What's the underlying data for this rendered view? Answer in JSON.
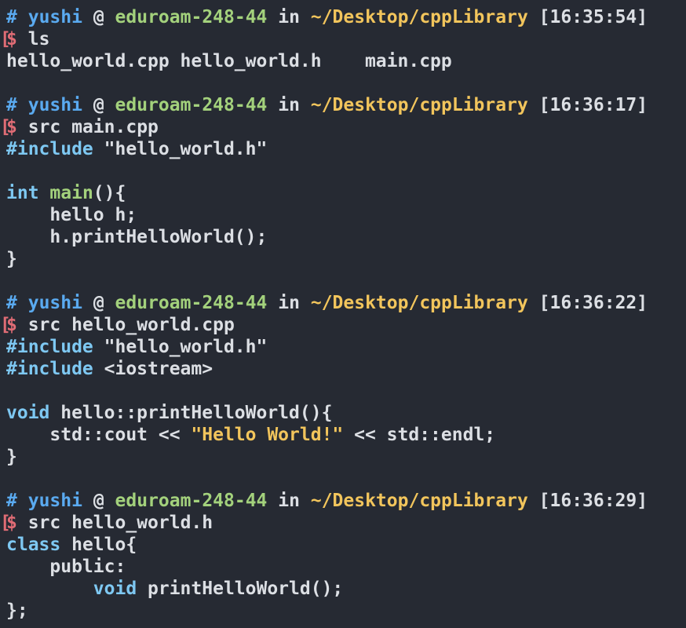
{
  "prompt": {
    "hash": "#",
    "user": "yushi",
    "at": "@",
    "host": "eduroam-248-44",
    "in": "in",
    "path": "~/Desktop/cppLibrary",
    "dollar": "$",
    "bracket": "["
  },
  "blocks": [
    {
      "time": "[16:35:54]",
      "command": "ls",
      "output": [
        "hello_world.cpp hello_world.h    main.cpp"
      ]
    },
    {
      "time": "[16:36:17]",
      "command": "src main.cpp",
      "code": {
        "pp1": "#include",
        "inc1": " \"hello_world.h\"",
        "kw_int": "int",
        "fn_main": "main",
        "main_rest": "(){",
        "l1": "    hello h;",
        "l2": "    h.printHelloWorld();",
        "close": "}"
      }
    },
    {
      "time": "[16:36:22]",
      "command": "src hello_world.cpp",
      "code": {
        "pp1": "#include",
        "inc1": " \"hello_world.h\"",
        "pp2": "#include",
        "inc2": " <iostream>",
        "kw_void": "void",
        "sig_rest": " hello::printHelloWorld(){",
        "cout_a": "    std::cout << ",
        "cout_str": "\"Hello World!\"",
        "cout_b": " << std::endl;",
        "close": "}"
      }
    },
    {
      "time": "[16:36:29]",
      "command": "src hello_world.h",
      "code": {
        "kw_class": "class",
        "class_rest": " hello{",
        "public": "    public:",
        "indent2": "        ",
        "kw_void": "void",
        "decl_rest": " printHelloWorld();",
        "close": "};"
      }
    }
  ]
}
